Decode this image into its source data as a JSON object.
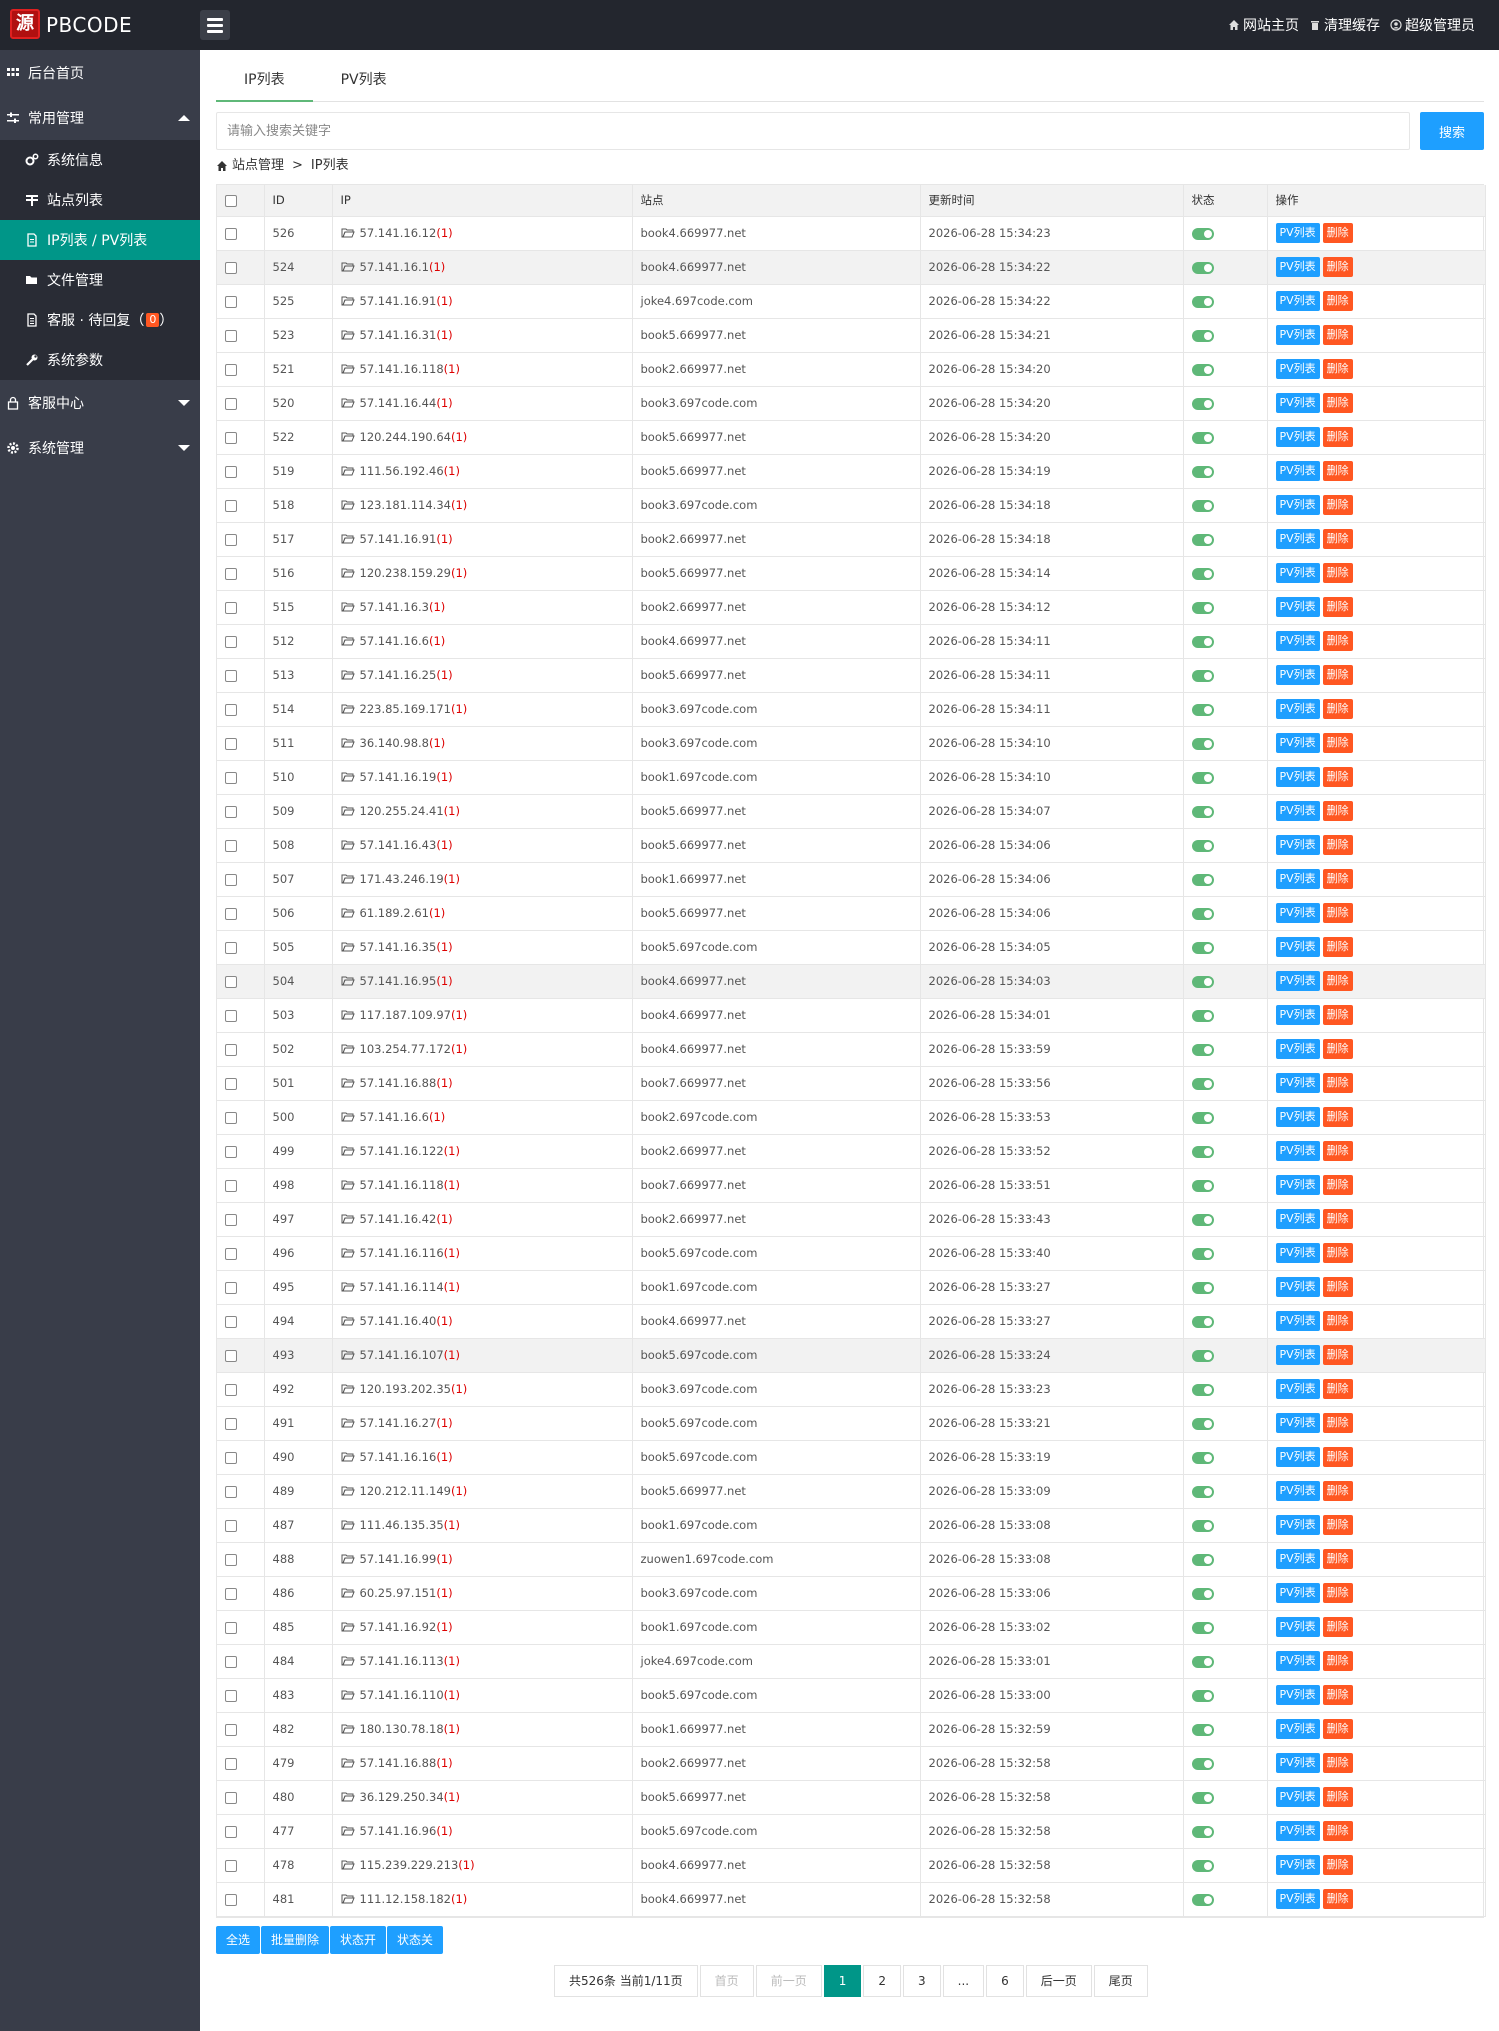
{
  "header": {
    "logo_char": "源",
    "brand": "PBCODE",
    "nav": [
      {
        "label": "网站主页",
        "icon": "home-icon"
      },
      {
        "label": "清理缓存",
        "icon": "trash-icon"
      },
      {
        "label": "超级管理员",
        "icon": "user-icon"
      }
    ]
  },
  "sidebar": {
    "dashboard": "后台首页",
    "common": "常用管理",
    "common_items": [
      "系统信息",
      "站点列表",
      "IP列表 / PV列表",
      "文件管理"
    ],
    "service_reply": "客服 · 待回复（",
    "service_badge": "0",
    "service_reply_end": "）",
    "params": "系统参数",
    "service_center": "客服中心",
    "system": "系统管理"
  },
  "tabs": [
    "IP列表",
    "PV列表"
  ],
  "search": {
    "placeholder": "请输入搜索关键字",
    "button": "搜索"
  },
  "breadcrumb": {
    "parent": "站点管理",
    "sep": ">",
    "current": "IP列表"
  },
  "table": {
    "columns": [
      "ID",
      "IP",
      "站点",
      "更新时间",
      "状态",
      "操作"
    ],
    "pv_label": "PV列表",
    "delete_label": "删除",
    "rows": [
      {
        "id": "526",
        "ip": "57.141.16.12",
        "count": "(1)",
        "site": "book4.669977.net",
        "time": "2026-06-28 15:34:23"
      },
      {
        "id": "524",
        "ip": "57.141.16.1",
        "count": "(1)",
        "site": "book4.669977.net",
        "time": "2026-06-28 15:34:22",
        "hl": true
      },
      {
        "id": "525",
        "ip": "57.141.16.91",
        "count": "(1)",
        "site": "joke4.697code.com",
        "time": "2026-06-28 15:34:22"
      },
      {
        "id": "523",
        "ip": "57.141.16.31",
        "count": "(1)",
        "site": "book5.669977.net",
        "time": "2026-06-28 15:34:21"
      },
      {
        "id": "521",
        "ip": "57.141.16.118",
        "count": "(1)",
        "site": "book2.669977.net",
        "time": "2026-06-28 15:34:20"
      },
      {
        "id": "520",
        "ip": "57.141.16.44",
        "count": "(1)",
        "site": "book3.697code.com",
        "time": "2026-06-28 15:34:20"
      },
      {
        "id": "522",
        "ip": "120.244.190.64",
        "count": "(1)",
        "site": "book5.669977.net",
        "time": "2026-06-28 15:34:20"
      },
      {
        "id": "519",
        "ip": "111.56.192.46",
        "count": "(1)",
        "site": "book5.669977.net",
        "time": "2026-06-28 15:34:19"
      },
      {
        "id": "518",
        "ip": "123.181.114.34",
        "count": "(1)",
        "site": "book3.697code.com",
        "time": "2026-06-28 15:34:18"
      },
      {
        "id": "517",
        "ip": "57.141.16.91",
        "count": "(1)",
        "site": "book2.669977.net",
        "time": "2026-06-28 15:34:18"
      },
      {
        "id": "516",
        "ip": "120.238.159.29",
        "count": "(1)",
        "site": "book5.669977.net",
        "time": "2026-06-28 15:34:14"
      },
      {
        "id": "515",
        "ip": "57.141.16.3",
        "count": "(1)",
        "site": "book2.669977.net",
        "time": "2026-06-28 15:34:12"
      },
      {
        "id": "512",
        "ip": "57.141.16.6",
        "count": "(1)",
        "site": "book4.669977.net",
        "time": "2026-06-28 15:34:11"
      },
      {
        "id": "513",
        "ip": "57.141.16.25",
        "count": "(1)",
        "site": "book5.669977.net",
        "time": "2026-06-28 15:34:11"
      },
      {
        "id": "514",
        "ip": "223.85.169.171",
        "count": "(1)",
        "site": "book3.697code.com",
        "time": "2026-06-28 15:34:11"
      },
      {
        "id": "511",
        "ip": "36.140.98.8",
        "count": "(1)",
        "site": "book3.697code.com",
        "time": "2026-06-28 15:34:10"
      },
      {
        "id": "510",
        "ip": "57.141.16.19",
        "count": "(1)",
        "site": "book1.697code.com",
        "time": "2026-06-28 15:34:10"
      },
      {
        "id": "509",
        "ip": "120.255.24.41",
        "count": "(1)",
        "site": "book5.669977.net",
        "time": "2026-06-28 15:34:07"
      },
      {
        "id": "508",
        "ip": "57.141.16.43",
        "count": "(1)",
        "site": "book5.669977.net",
        "time": "2026-06-28 15:34:06"
      },
      {
        "id": "507",
        "ip": "171.43.246.19",
        "count": "(1)",
        "site": "book1.669977.net",
        "time": "2026-06-28 15:34:06"
      },
      {
        "id": "506",
        "ip": "61.189.2.61",
        "count": "(1)",
        "site": "book5.669977.net",
        "time": "2026-06-28 15:34:06"
      },
      {
        "id": "505",
        "ip": "57.141.16.35",
        "count": "(1)",
        "site": "book5.697code.com",
        "time": "2026-06-28 15:34:05"
      },
      {
        "id": "504",
        "ip": "57.141.16.95",
        "count": "(1)",
        "site": "book4.669977.net",
        "time": "2026-06-28 15:34:03",
        "hl": true
      },
      {
        "id": "503",
        "ip": "117.187.109.97",
        "count": "(1)",
        "site": "book4.669977.net",
        "time": "2026-06-28 15:34:01"
      },
      {
        "id": "502",
        "ip": "103.254.77.172",
        "count": "(1)",
        "site": "book4.669977.net",
        "time": "2026-06-28 15:33:59"
      },
      {
        "id": "501",
        "ip": "57.141.16.88",
        "count": "(1)",
        "site": "book7.669977.net",
        "time": "2026-06-28 15:33:56"
      },
      {
        "id": "500",
        "ip": "57.141.16.6",
        "count": "(1)",
        "site": "book2.697code.com",
        "time": "2026-06-28 15:33:53"
      },
      {
        "id": "499",
        "ip": "57.141.16.122",
        "count": "(1)",
        "site": "book2.669977.net",
        "time": "2026-06-28 15:33:52"
      },
      {
        "id": "498",
        "ip": "57.141.16.118",
        "count": "(1)",
        "site": "book7.669977.net",
        "time": "2026-06-28 15:33:51"
      },
      {
        "id": "497",
        "ip": "57.141.16.42",
        "count": "(1)",
        "site": "book2.669977.net",
        "time": "2026-06-28 15:33:43"
      },
      {
        "id": "496",
        "ip": "57.141.16.116",
        "count": "(1)",
        "site": "book5.697code.com",
        "time": "2026-06-28 15:33:40"
      },
      {
        "id": "495",
        "ip": "57.141.16.114",
        "count": "(1)",
        "site": "book1.697code.com",
        "time": "2026-06-28 15:33:27"
      },
      {
        "id": "494",
        "ip": "57.141.16.40",
        "count": "(1)",
        "site": "book4.669977.net",
        "time": "2026-06-28 15:33:27"
      },
      {
        "id": "493",
        "ip": "57.141.16.107",
        "count": "(1)",
        "site": "book5.697code.com",
        "time": "2026-06-28 15:33:24",
        "hl": true
      },
      {
        "id": "492",
        "ip": "120.193.202.35",
        "count": "(1)",
        "site": "book3.697code.com",
        "time": "2026-06-28 15:33:23"
      },
      {
        "id": "491",
        "ip": "57.141.16.27",
        "count": "(1)",
        "site": "book5.697code.com",
        "time": "2026-06-28 15:33:21"
      },
      {
        "id": "490",
        "ip": "57.141.16.16",
        "count": "(1)",
        "site": "book5.697code.com",
        "time": "2026-06-28 15:33:19"
      },
      {
        "id": "489",
        "ip": "120.212.11.149",
        "count": "(1)",
        "site": "book5.669977.net",
        "time": "2026-06-28 15:33:09"
      },
      {
        "id": "487",
        "ip": "111.46.135.35",
        "count": "(1)",
        "site": "book1.697code.com",
        "time": "2026-06-28 15:33:08"
      },
      {
        "id": "488",
        "ip": "57.141.16.99",
        "count": "(1)",
        "site": "zuowen1.697code.com",
        "time": "2026-06-28 15:33:08"
      },
      {
        "id": "486",
        "ip": "60.25.97.151",
        "count": "(1)",
        "site": "book3.697code.com",
        "time": "2026-06-28 15:33:06"
      },
      {
        "id": "485",
        "ip": "57.141.16.92",
        "count": "(1)",
        "site": "book1.697code.com",
        "time": "2026-06-28 15:33:02"
      },
      {
        "id": "484",
        "ip": "57.141.16.113",
        "count": "(1)",
        "site": "joke4.697code.com",
        "time": "2026-06-28 15:33:01"
      },
      {
        "id": "483",
        "ip": "57.141.16.110",
        "count": "(1)",
        "site": "book5.697code.com",
        "time": "2026-06-28 15:33:00"
      },
      {
        "id": "482",
        "ip": "180.130.78.18",
        "count": "(1)",
        "site": "book1.669977.net",
        "time": "2026-06-28 15:32:59"
      },
      {
        "id": "479",
        "ip": "57.141.16.88",
        "count": "(1)",
        "site": "book2.669977.net",
        "time": "2026-06-28 15:32:58"
      },
      {
        "id": "480",
        "ip": "36.129.250.34",
        "count": "(1)",
        "site": "book5.669977.net",
        "time": "2026-06-28 15:32:58"
      },
      {
        "id": "477",
        "ip": "57.141.16.96",
        "count": "(1)",
        "site": "book5.697code.com",
        "time": "2026-06-28 15:32:58"
      },
      {
        "id": "478",
        "ip": "115.239.229.213",
        "count": "(1)",
        "site": "book4.669977.net",
        "time": "2026-06-28 15:32:58"
      },
      {
        "id": "481",
        "ip": "111.12.158.182",
        "count": "(1)",
        "site": "book4.669977.net",
        "time": "2026-06-28 15:32:58"
      }
    ]
  },
  "bulk_actions": [
    "全选",
    "批量删除",
    "状态开",
    "状态关"
  ],
  "pagination": {
    "summary": "共526条 当前1/11页",
    "first": "首页",
    "prev": "前一页",
    "pages": [
      "1",
      "2",
      "3",
      "...",
      "6"
    ],
    "current": "1",
    "next": "后一页",
    "last": "尾页"
  },
  "colors": {
    "sidebar_bg": "#393d49",
    "header_bg": "#23262e",
    "active": "#009688",
    "primary": "#1e9fff",
    "danger": "#ff5722",
    "switch_on": "#5fb878"
  }
}
